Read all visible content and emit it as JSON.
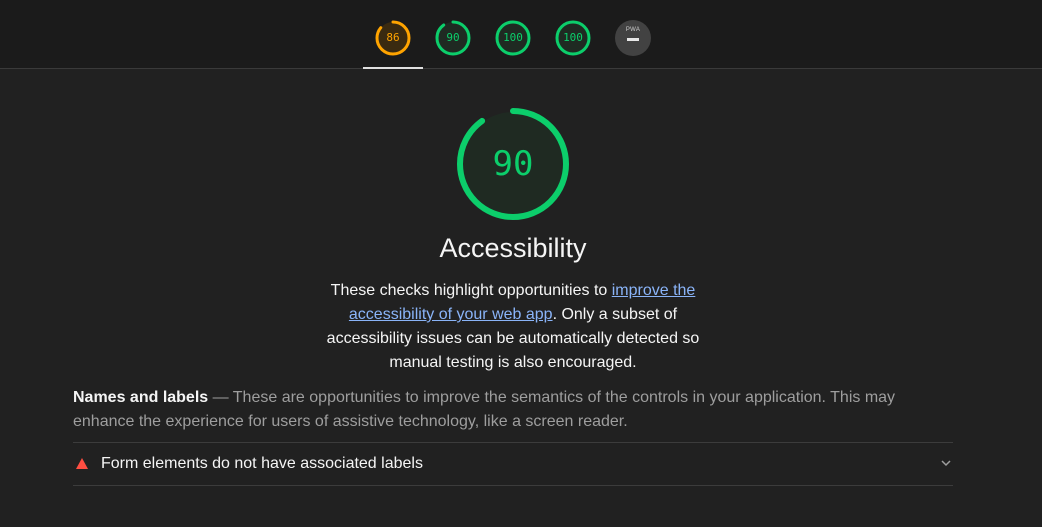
{
  "header": {
    "gauges": [
      {
        "score": "86",
        "value": 0.86,
        "color": "#ffa400",
        "bg": "#3a2a10"
      },
      {
        "score": "90",
        "value": 0.9,
        "color": "#0cce6b",
        "bg": "#1f2a22"
      },
      {
        "score": "100",
        "value": 1.0,
        "color": "#0cce6b",
        "bg": "#1f2a22"
      },
      {
        "score": "100",
        "value": 1.0,
        "color": "#0cce6b",
        "bg": "#1f2a22"
      }
    ],
    "pwa_label": "PWA"
  },
  "category": {
    "score": "90",
    "score_value": 0.9,
    "color": "#0cce6b",
    "title": "Accessibility",
    "desc_before": "These checks highlight opportunities to ",
    "desc_link": "improve the accessibility of your web app",
    "desc_after": ". Only a subset of accessibility issues can be automatically detected so manual testing is also encouraged."
  },
  "group": {
    "title": "Names and labels",
    "separator": " — ",
    "description": "These are opportunities to improve the semantics of the controls in your application. This may enhance the experience for users of assistive technology, like a screen reader."
  },
  "audit": {
    "title": "Form elements do not have associated labels",
    "status_color": "#ff4e42"
  },
  "icons": {
    "fail": "triangle-fail-icon",
    "expand": "chevron-down-icon"
  }
}
